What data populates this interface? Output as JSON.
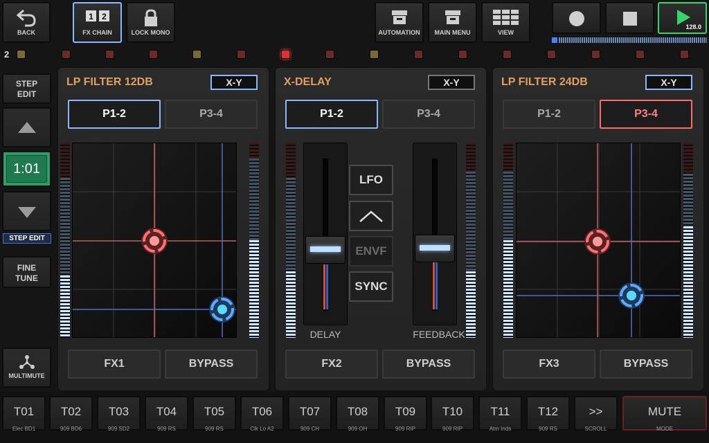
{
  "toolbar": {
    "back": "BACK",
    "fx_chain": "FX CHAIN",
    "lock_mono": "LOCK MONO",
    "automation": "AUTOMATION",
    "main_menu": "MAIN MENU",
    "view": "VIEW",
    "tempo": "128.0"
  },
  "led_row": {
    "label": "2"
  },
  "left_controls": {
    "step_edit_top": "STEP\nEDIT",
    "position": "1:01",
    "step_edit_label": "STEP EDIT",
    "fine_tune": "FINE\nTUNE",
    "multimute": "MULTIMUTE"
  },
  "panels": [
    {
      "title": "LP FILTER 12DB",
      "mode": "X-Y",
      "tabs": [
        "P1-2",
        "P3-4"
      ],
      "active_tab": "P1-2",
      "fx_button": "FX1",
      "bypass": "BYPASS"
    },
    {
      "title": "X-DELAY",
      "mode": "X-Y",
      "tabs": [
        "P1-2",
        "P3-4"
      ],
      "active_tab": "P1-2",
      "fader_labels": [
        "DELAY",
        "FEEDBACK"
      ],
      "mod_buttons": [
        "LFO",
        "ENVF",
        "SYNC"
      ],
      "fx_button": "FX2",
      "bypass": "BYPASS"
    },
    {
      "title": "LP FILTER 24DB",
      "mode": "X-Y",
      "tabs": [
        "P1-2",
        "P3-4"
      ],
      "active_tab": "P3-4",
      "fx_button": "FX3",
      "bypass": "BYPASS"
    }
  ],
  "tracks": [
    {
      "name": "T01",
      "sub": "Elec BD1"
    },
    {
      "name": "T02",
      "sub": "909 BD6"
    },
    {
      "name": "T03",
      "sub": "909 SD2"
    },
    {
      "name": "T04",
      "sub": "909 RS"
    },
    {
      "name": "T05",
      "sub": "909 RS"
    },
    {
      "name": "T06",
      "sub": "Clk Lo A2"
    },
    {
      "name": "T07",
      "sub": "909 CH"
    },
    {
      "name": "T08",
      "sub": "909 OH"
    },
    {
      "name": "T09",
      "sub": "909 RIP"
    },
    {
      "name": "T10",
      "sub": "909 RIP"
    },
    {
      "name": "T11",
      "sub": "Atm Inds"
    },
    {
      "name": "T12",
      "sub": "909 RS"
    }
  ],
  "scroll": {
    "label": ">>",
    "sub": "SCROLL"
  },
  "mute": {
    "label": "MUTE",
    "sub": "MODE"
  },
  "colors": {
    "accent_blue": "#8ab8ff",
    "accent_red": "#ff6a6a",
    "title_orange": "#e0a060",
    "play_green": "#37d46a"
  }
}
